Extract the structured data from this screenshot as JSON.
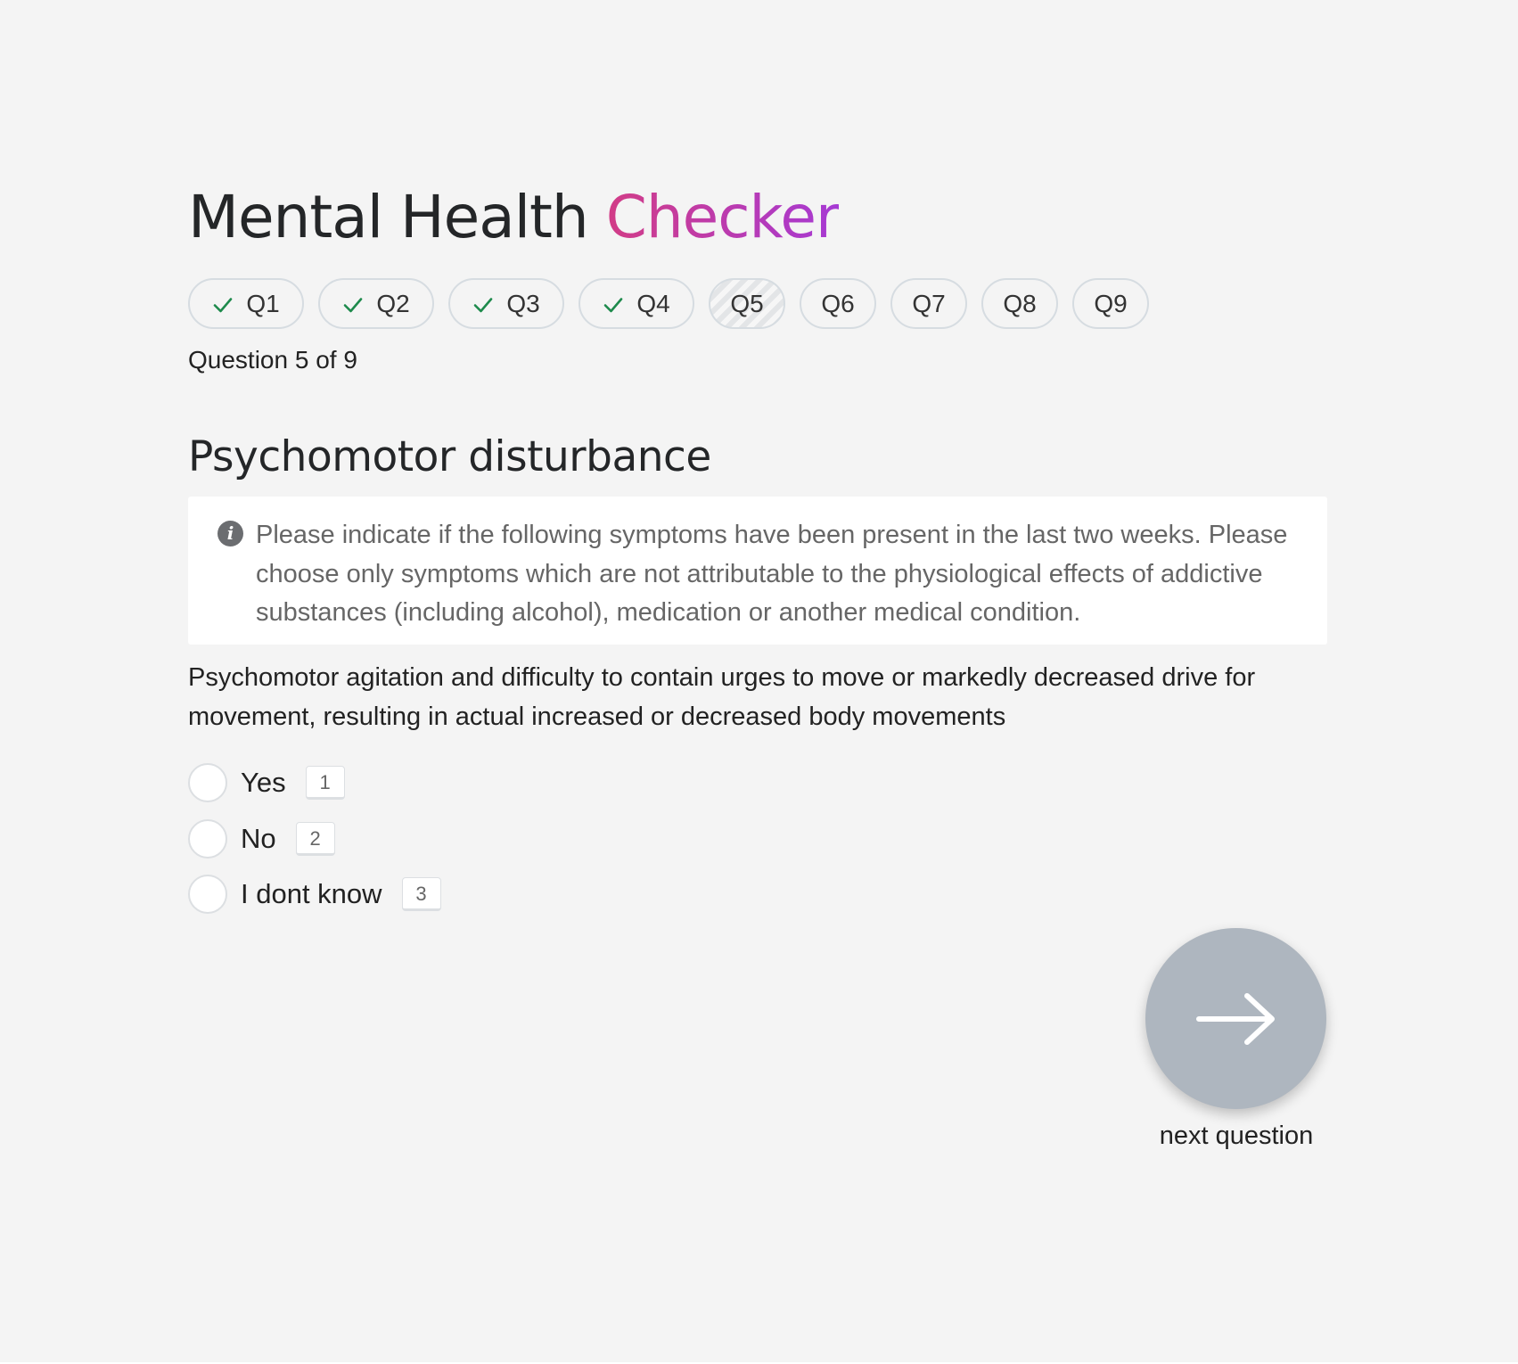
{
  "app": {
    "title_main": "Mental Health ",
    "title_accent": "Checker",
    "accent_gradient": [
      "#d23c86",
      "#a63ad4"
    ]
  },
  "nav": {
    "check_color": "#1e8a4c",
    "items": [
      {
        "label": "Q1",
        "status": "done"
      },
      {
        "label": "Q2",
        "status": "done"
      },
      {
        "label": "Q3",
        "status": "done"
      },
      {
        "label": "Q4",
        "status": "done"
      },
      {
        "label": "Q5",
        "status": "current"
      },
      {
        "label": "Q6",
        "status": "todo"
      },
      {
        "label": "Q7",
        "status": "todo"
      },
      {
        "label": "Q8",
        "status": "todo"
      },
      {
        "label": "Q9",
        "status": "todo"
      }
    ]
  },
  "progress": {
    "text": "Question 5 of 9"
  },
  "question": {
    "title": "Psychomotor disturbance",
    "info_icon": "info-icon",
    "info_text": "Please indicate if the following symptoms have been present in the last two weeks. Please choose only symptoms which are not attributable to the physiological effects of addictive substances (including alcohol), medication or another medical condition.",
    "text": "Psychomotor agitation and difficulty to contain urges to move or markedly decreased drive for movement, resulting in actual increased or decreased body movements",
    "options": [
      {
        "label": "Yes",
        "key": "1"
      },
      {
        "label": "No",
        "key": "2"
      },
      {
        "label": "I dont know",
        "key": "3"
      }
    ]
  },
  "next": {
    "label": "next question",
    "icon": "arrow-right-icon",
    "color": "#aeb6bf"
  }
}
